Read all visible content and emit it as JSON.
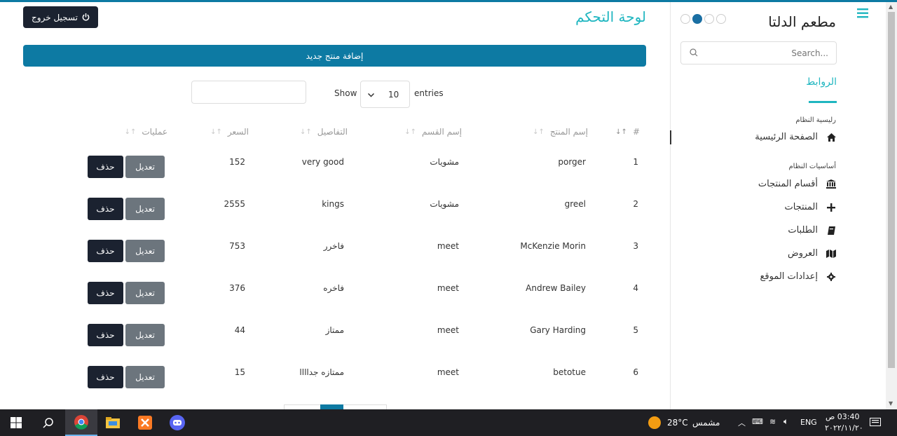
{
  "sidebar": {
    "brand": "مطعم الدلتا",
    "search_placeholder": "Search...",
    "links_title": "الروابط",
    "section_main": "رليسية النظام",
    "section_basics": "أساسيات النظام",
    "items": [
      {
        "label": "الصفحة الرئيسية",
        "icon": "home-icon"
      },
      {
        "label": "أقسام المنتجات",
        "icon": "bank-icon"
      },
      {
        "label": "المنتجات",
        "icon": "plus-icon"
      },
      {
        "label": "الطلبات",
        "icon": "book-icon"
      },
      {
        "label": "العروض",
        "icon": "map-icon"
      },
      {
        "label": "إعدادات الموقع",
        "icon": "gear-icon"
      }
    ]
  },
  "header": {
    "title": "لوحة التحكم",
    "logout_label": "تسجيل خروج"
  },
  "main": {
    "add_button": "إضافة منتج جديد",
    "show_label": "Show",
    "entries_value": "10",
    "entries_label": "entries"
  },
  "table": {
    "headers": {
      "index": "#",
      "name": "إسم المنتج",
      "category": "إسم القسم",
      "details": "التفاصيل",
      "price": "السعر",
      "actions": "عمليات"
    },
    "edit_label": "تعديل",
    "delete_label": "حذف",
    "rows": [
      {
        "index": "1",
        "name": "porger",
        "category": "مشويات",
        "details": "very good",
        "price": "152"
      },
      {
        "index": "2",
        "name": "greel",
        "category": "مشويات",
        "details": "kings",
        "price": "2555"
      },
      {
        "index": "3",
        "name": "McKenzie Morin",
        "category": "meet",
        "details": "فاخرر",
        "price": "753"
      },
      {
        "index": "4",
        "name": "Andrew Bailey",
        "category": "meet",
        "details": "فاخره",
        "price": "376"
      },
      {
        "index": "5",
        "name": "Gary Harding",
        "category": "meet",
        "details": "ممتاز",
        "price": "44"
      },
      {
        "index": "6",
        "name": "betotue",
        "category": "meet",
        "details": "ممتازه جداااا",
        "price": "15"
      }
    ]
  },
  "taskbar": {
    "weather_temp": "28°C",
    "weather_label": "مشمس",
    "lang": "ENG",
    "time": "03:40 ص",
    "date": "٢٠٢٢/١١/٢٠"
  },
  "colors": {
    "accent": "#1fb6c0",
    "primary": "#0d7aa3",
    "dark": "#1b2230",
    "secondary": "#6c757d"
  }
}
